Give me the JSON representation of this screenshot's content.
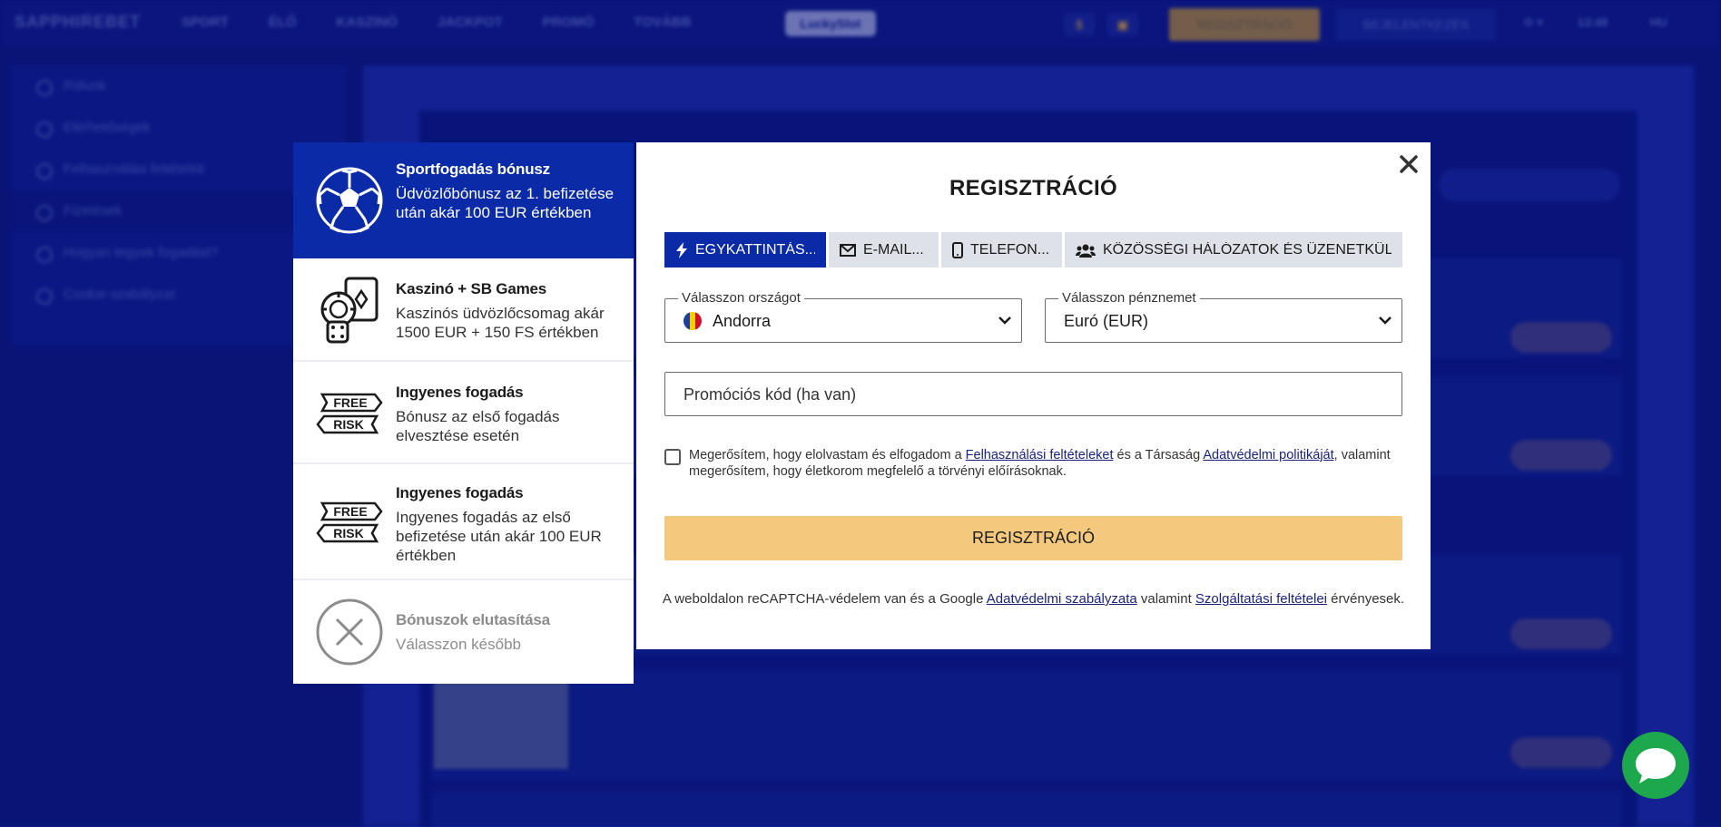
{
  "header": {
    "logo": "SAPPHIREBET",
    "nav": [
      "SPORT",
      "ÉLŐ",
      "KASZINÓ",
      "JACKPOT",
      "PROMÓ",
      "TOVÁBB"
    ],
    "lucky_label": "LuckySlot",
    "register_label": "REGISZTRÁCIÓ",
    "login_label": "BEJELENTKEZÉS",
    "time": "13:48",
    "language": "HU"
  },
  "sidebar": {
    "items": [
      "Rólunk",
      "Elérhetőségek",
      "Felhasználási feltételek",
      "Fizetések",
      "Hogyan tegyek fogadást?",
      "Cookie-szabályzat"
    ]
  },
  "bonuses": [
    {
      "title": "Sportfogadás bónusz",
      "desc": "Üdvözlőbónusz az 1. befizetése után akár 100 EUR értékben"
    },
    {
      "title": "Kaszinó + SB Games",
      "desc": "Kaszinós üdvözlőcsomag akár 1500 EUR + 150 FS értékben"
    },
    {
      "title": "Ingyenes fogadás",
      "desc": "Bónusz az első fogadás elvesztése esetén"
    },
    {
      "title": "Ingyenes fogadás",
      "desc": "Ingyenes fogadás az első befizetése után akár 100 EUR értékben"
    },
    {
      "title": "Bónuszok elutasítása",
      "desc": "Válasszon később"
    }
  ],
  "free_risk": {
    "free": "FREE",
    "risk": "RISK"
  },
  "modal": {
    "title": "REGISZTRÁCIÓ",
    "tabs": [
      "EGYKATTINTÁS...",
      "E-MAIL...",
      "TELEFON...",
      "KÖZÖSSÉGI HÁLÓZATOK ÉS ÜZENETKÜLD..."
    ],
    "country": {
      "label": "Válasszon országot",
      "value": "Andorra"
    },
    "currency": {
      "label": "Válasszon pénznemet",
      "value": "Euró (EUR)"
    },
    "promo_placeholder": "Promóciós kód (ha van)",
    "terms": {
      "part1": "Megerősítem, hogy elolvastam és elfogadom a ",
      "link1": "Felhasználási feltételeket",
      "part2": " és a Társaság ",
      "link2": "Adatvédelmi politikáját",
      "part3": ", valamint megerősítem, hogy életkorom megfelelő a törvényi előírásoknak."
    },
    "register_button": "REGISZTRÁCIÓ",
    "captcha": {
      "part1": "A weboldalon reCAPTCHA-védelem van és a Google ",
      "link1": "Adatvédelmi szabályzata",
      "part2": " valamint ",
      "link2": "Szolgáltatási feltételei",
      "part3": " érvényesek."
    }
  },
  "colors": {
    "primary": "#0a2aa8",
    "accent": "#f5c97d",
    "chat": "#1ea84e"
  }
}
